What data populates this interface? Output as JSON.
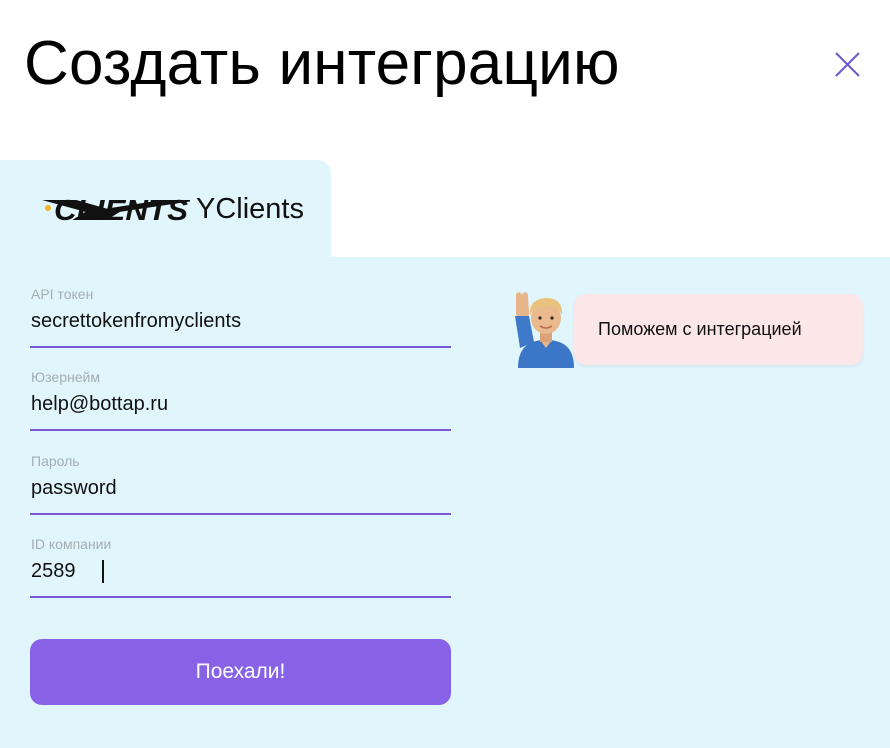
{
  "dialog": {
    "title": "Создать интеграцию",
    "close_icon": "close-icon"
  },
  "tab": {
    "logo_text": "Y·CLIENTS",
    "label": "YClients"
  },
  "form": {
    "fields": [
      {
        "label": "API токен",
        "value": "secrettokenfromyclients"
      },
      {
        "label": "Юзернейм",
        "value": "help@bottap.ru"
      },
      {
        "label": "Пароль",
        "value": "password"
      },
      {
        "label": "ID компании",
        "value": "2589"
      }
    ],
    "submit_label": "Поехали!"
  },
  "help": {
    "avatar_icon": "waving-person-icon",
    "text": "Поможем с интеграцией"
  },
  "colors": {
    "panel_bg": "#e0f6fc",
    "accent": "#8761e6",
    "underline": "#7a57d8",
    "help_bg": "#fbe6e8",
    "close_icon": "#6a5ad0",
    "label_gray": "#a3aeb3"
  }
}
